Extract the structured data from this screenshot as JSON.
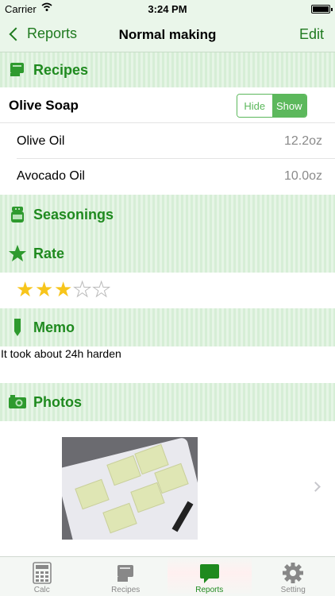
{
  "status_bar": {
    "carrier": "Carrier",
    "time": "3:24 PM"
  },
  "nav": {
    "back_label": "Reports",
    "title": "Normal making",
    "edit_label": "Edit"
  },
  "sections": {
    "recipes": "Recipes",
    "seasonings": "Seasonings",
    "rate": "Rate",
    "memo": "Memo",
    "photos": "Photos"
  },
  "recipe": {
    "name": "Olive Soap",
    "toggle": {
      "hide_label": "Hide",
      "show_label": "Show",
      "selected": "Show"
    },
    "ingredients": [
      {
        "name": "Olive Oil",
        "amount": "12.2oz"
      },
      {
        "name": "Avocado Oil",
        "amount": "10.0oz"
      }
    ]
  },
  "rating": {
    "value": 3,
    "max": 5
  },
  "memo": {
    "text": "It took about 24h harden"
  },
  "tabs": [
    {
      "label": "Calc",
      "icon": "calculator-icon",
      "active": false
    },
    {
      "label": "Recipes",
      "icon": "recipe-book-icon",
      "active": false
    },
    {
      "label": "Reports",
      "icon": "speech-bubble-icon",
      "active": true
    },
    {
      "label": "Setting",
      "icon": "gear-icon",
      "active": false
    }
  ],
  "colors": {
    "accent": "#1f8a1f",
    "toggle": "#5cb85c",
    "star": "#f7c51b"
  }
}
